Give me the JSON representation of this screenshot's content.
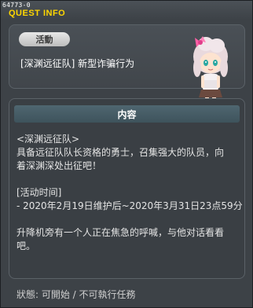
{
  "window": {
    "quest_id": "64773-0",
    "title": "QUEST INFO"
  },
  "header": {
    "type_label": "活動",
    "quest_name": "[深渊远征队] 新型诈骗行为"
  },
  "content": {
    "section_title": "内容",
    "lines": [
      "<深渊远征队>",
      "具备远征队队长资格的勇士，召集强大的队员，向",
      "着深渊深处出征吧！",
      "",
      "[活动时间]",
      " - 2020年2月19日维护后~2020年3月31日23点59分",
      "",
      "升降机旁有一个人正在焦急的呼喊，与他对话看看",
      "吧。"
    ]
  },
  "status": {
    "text": "狀態: 可開始 / 不可執行任務"
  },
  "colors": {
    "title_yellow": "#ffd700",
    "panel_bg": "#3d4247",
    "section_header": "#4a606a"
  }
}
